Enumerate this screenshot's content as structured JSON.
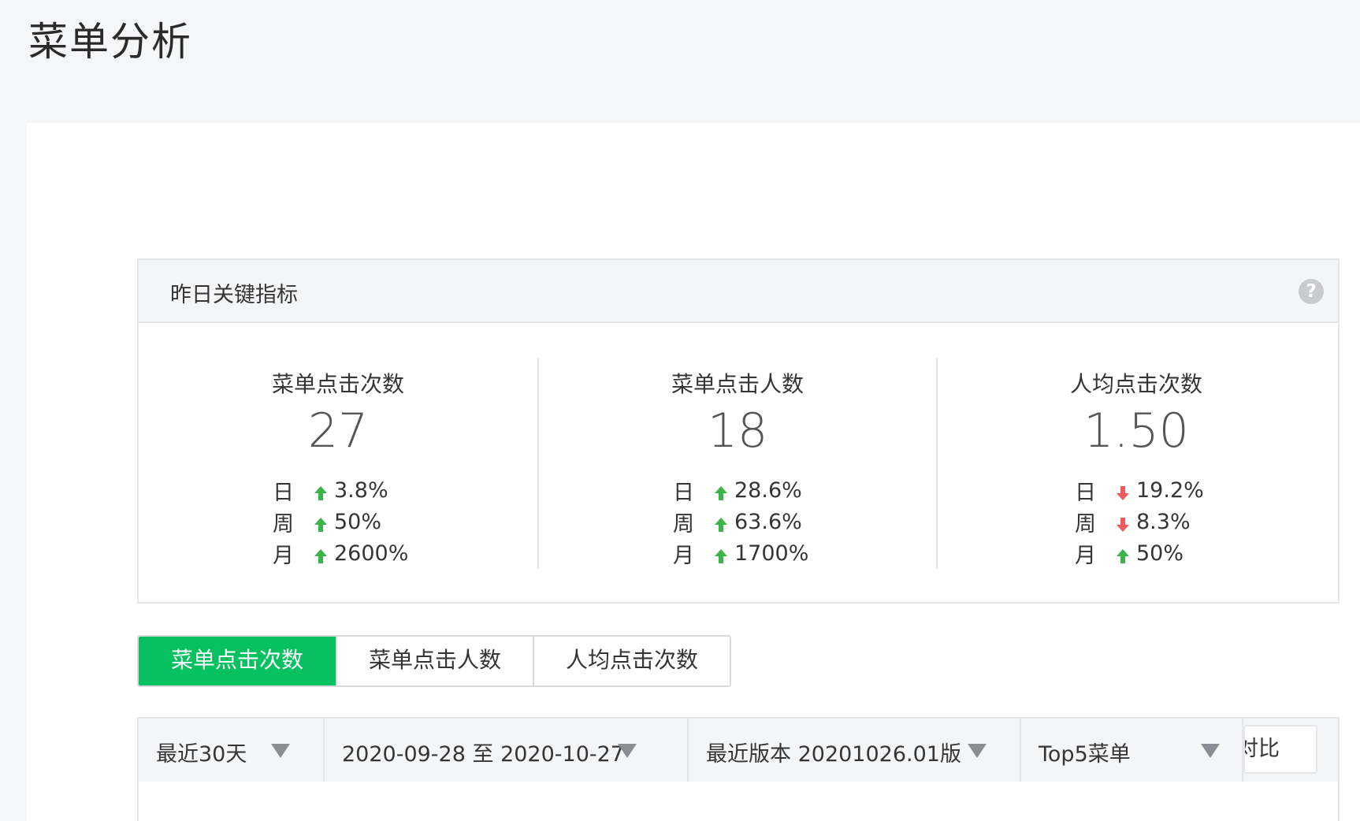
{
  "page": {
    "title": "菜单分析"
  },
  "kpi": {
    "title": "昨日关键指标",
    "help_icon": "?",
    "metrics": [
      {
        "label": "菜单点击次数",
        "value": "27",
        "changes": [
          {
            "period": "日",
            "direction": "up",
            "value": "3.8%"
          },
          {
            "period": "周",
            "direction": "up",
            "value": "50%"
          },
          {
            "period": "月",
            "direction": "up",
            "value": "2600%"
          }
        ]
      },
      {
        "label": "菜单点击人数",
        "value": "18",
        "changes": [
          {
            "period": "日",
            "direction": "up",
            "value": "28.6%"
          },
          {
            "period": "周",
            "direction": "up",
            "value": "63.6%"
          },
          {
            "period": "月",
            "direction": "up",
            "value": "1700%"
          }
        ]
      },
      {
        "label": "人均点击次数",
        "value": "1.50",
        "changes": [
          {
            "period": "日",
            "direction": "down",
            "value": "19.2%"
          },
          {
            "period": "周",
            "direction": "down",
            "value": "8.3%"
          },
          {
            "period": "月",
            "direction": "up",
            "value": "50%"
          }
        ]
      }
    ]
  },
  "tabs": [
    {
      "label": "菜单点击次数",
      "active": true
    },
    {
      "label": "菜单点击人数",
      "active": false
    },
    {
      "label": "人均点击次数",
      "active": false
    }
  ],
  "filters": {
    "range": "最近30天",
    "dates": "2020-09-28 至 2020-10-27",
    "version": "最近版本 20201026.01版",
    "menu": "Top5菜单",
    "compare": "对比"
  },
  "colors": {
    "accent": "#07c160",
    "up_arrow": "#3bb54a",
    "down_arrow": "#f05a5a"
  }
}
